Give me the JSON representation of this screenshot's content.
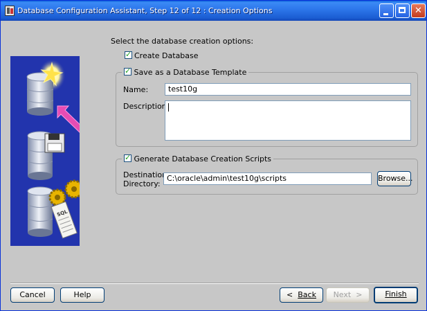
{
  "window": {
    "title": "Database Configuration Assistant, Step 12 of 12 : Creation Options"
  },
  "content": {
    "prompt": "Select the database creation options:",
    "create_database": {
      "label": "Create Database",
      "checked": true
    },
    "save_template": {
      "label": "Save as a Database Template",
      "checked": true,
      "name_label": "Name:",
      "name_value": "test10g",
      "description_label": "Description:",
      "description_value": ""
    },
    "scripts": {
      "label": "Generate Database Creation Scripts",
      "checked": true,
      "dest_label_line1": "Destination",
      "dest_label_line2": "Directory:",
      "dest_value": "C:\\oracle\\admin\\test10g\\scripts",
      "browse_label": "Browse..."
    }
  },
  "footer": {
    "cancel": "Cancel",
    "help": "Help",
    "back": "Back",
    "next": "Next",
    "finish": "Finish"
  },
  "art": {
    "sql_text": "SQL"
  }
}
